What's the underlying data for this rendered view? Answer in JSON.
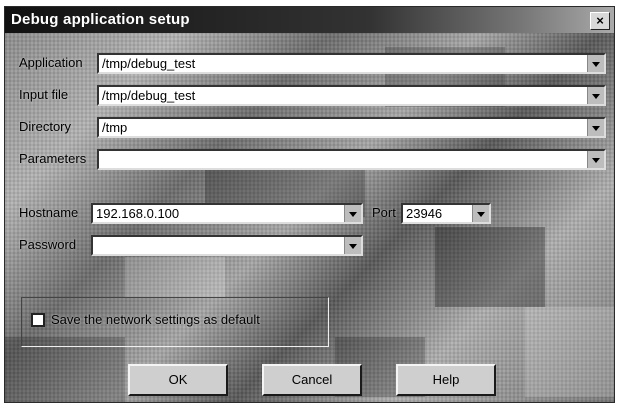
{
  "dialog": {
    "title": "Debug application setup",
    "close_label": "×"
  },
  "fields": {
    "application": {
      "label": "Application",
      "value": "/tmp/debug_test"
    },
    "input_file": {
      "label": "Input file",
      "value": "/tmp/debug_test"
    },
    "directory": {
      "label": "Directory",
      "value": "/tmp"
    },
    "parameters": {
      "label": "Parameters",
      "value": ""
    },
    "hostname": {
      "label": "Hostname",
      "value": "192.168.0.100"
    },
    "port": {
      "label": "Port",
      "value": "23946"
    },
    "password": {
      "label": "Password",
      "value": ""
    }
  },
  "save_default": {
    "label": "Save the network settings as default",
    "checked": false
  },
  "buttons": {
    "ok": "OK",
    "cancel": "Cancel",
    "help": "Help"
  }
}
